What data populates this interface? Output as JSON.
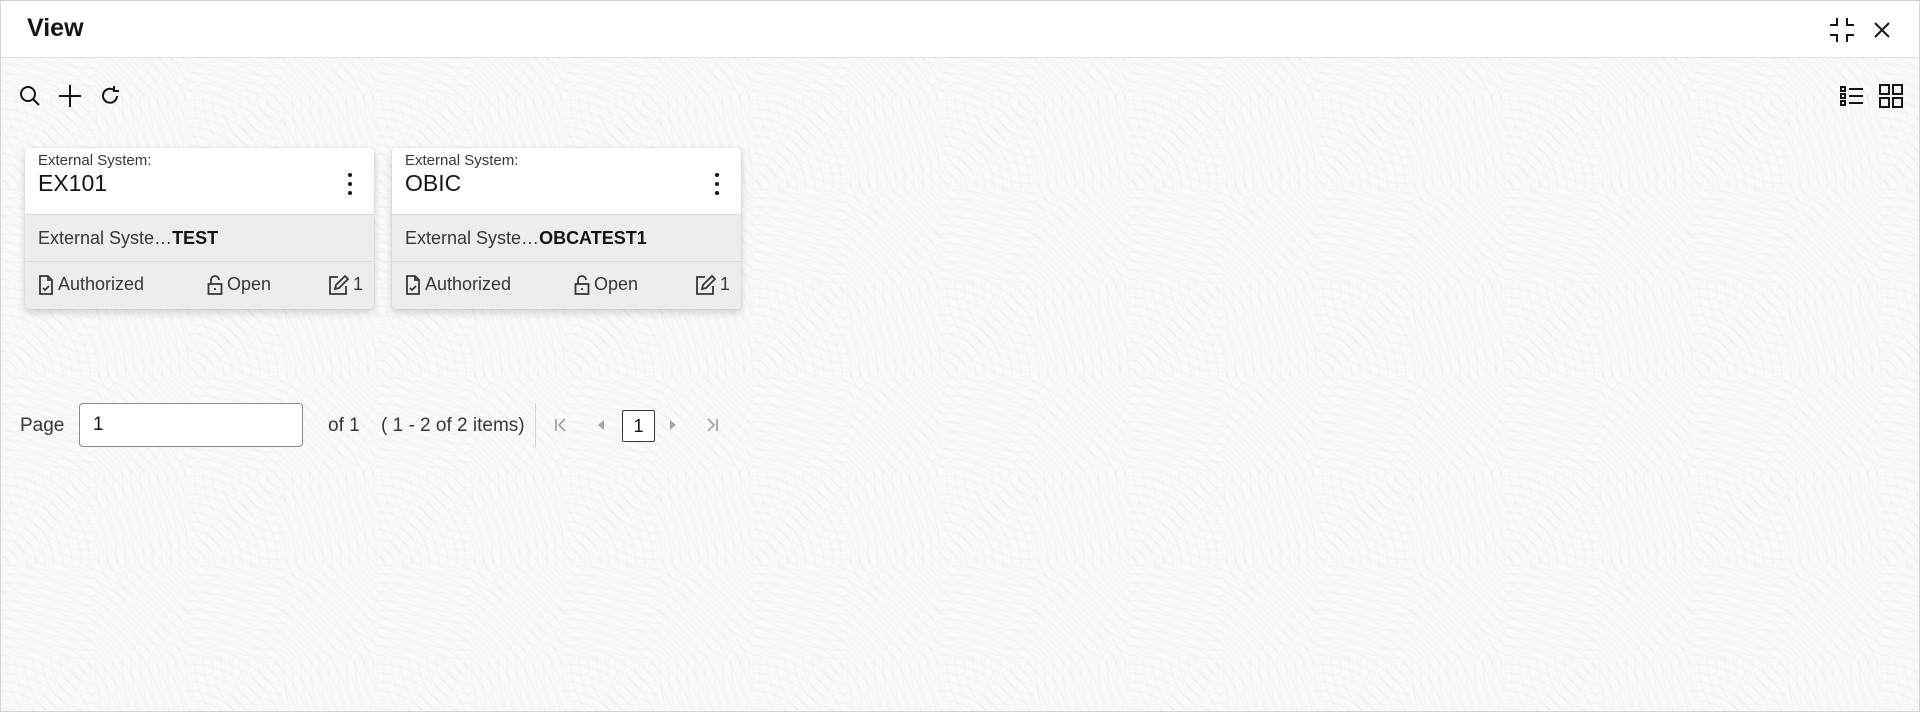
{
  "window": {
    "title": "View"
  },
  "header_icons": [
    "compress-icon",
    "close-icon"
  ],
  "toolbar": {
    "icons": [
      "search-icon",
      "add-icon",
      "refresh-icon"
    ],
    "view_icons": [
      "list-view-icon",
      "grid-view-icon"
    ]
  },
  "cards": [
    {
      "label": "External System:",
      "value": "EX101",
      "description_prefix": "External Syste…",
      "description_value": "TEST",
      "status": "Authorized",
      "lock_status": "Open",
      "edit_count": "1"
    },
    {
      "label": "External System:",
      "value": "OBIC",
      "description_prefix": "External Syste…",
      "description_value": "OBCATEST1",
      "status": "Authorized",
      "lock_status": "Open",
      "edit_count": "1"
    }
  ],
  "pagination": {
    "page_label": "Page",
    "page_value": "1",
    "of_text": "of 1",
    "items_text": "( 1 - 2 of 2 items)",
    "current_page": "1"
  }
}
